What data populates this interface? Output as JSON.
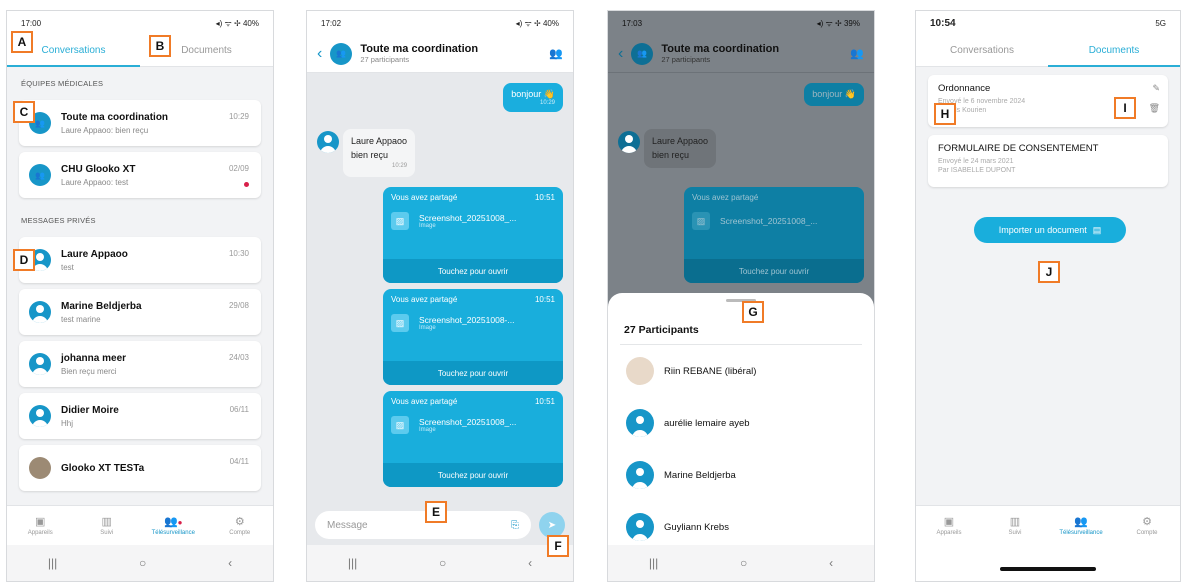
{
  "screens": {
    "conversations": {
      "status_time": "17:00",
      "status_right": "◂) ᯤ ✢ 40%",
      "tab_conversations": "Conversations",
      "tab_documents": "Documents",
      "section_medical": "ÉQUIPES MÉDICALES",
      "section_private": "MESSAGES PRIVÉS",
      "teams": [
        {
          "name": "Toute ma coordination",
          "preview": "Laure Appaoo: bien reçu",
          "date": "10:29"
        },
        {
          "name": "CHU Glooko XT",
          "preview": "Laure Appaoo: test",
          "date": "02/09"
        }
      ],
      "private": [
        {
          "name": "Laure Appaoo",
          "preview": "test",
          "date": "10:30"
        },
        {
          "name": "Marine Beldjerba",
          "preview": "test marine",
          "date": "29/08"
        },
        {
          "name": "johanna meer",
          "preview": "Bien reçu merci",
          "date": "24/03"
        },
        {
          "name": "Didier Moire",
          "preview": "Hhj",
          "date": "06/11"
        },
        {
          "name": "Glooko XT TESTa",
          "preview": "",
          "date": "04/11"
        }
      ]
    },
    "chat": {
      "status_time": "17:02",
      "status_right": "◂) ᯤ ✢ 40%",
      "title": "Toute ma coordination",
      "participants": "27 participants",
      "msg_out": "bonjour 👋",
      "msg_out_time": "10:29",
      "msg_in_author": "Laure Appaoo",
      "msg_in_text": "bien reçu",
      "msg_in_time": "10:29",
      "shares": [
        {
          "head": "Vous avez partagé",
          "time": "10:51",
          "file": "Screenshot_20251008_...",
          "type": "Image",
          "open": "Touchez pour ouvrir"
        },
        {
          "head": "Vous avez partagé",
          "time": "10:51",
          "file": "Screenshot_20251008-...",
          "type": "Image",
          "open": "Touchez pour ouvrir"
        },
        {
          "head": "Vous avez partagé",
          "time": "10:51",
          "file": "Screenshot_20251008_...",
          "type": "Image",
          "open": "Touchez pour ouvrir"
        }
      ],
      "input_placeholder": "Message"
    },
    "participants": {
      "status_time": "17:03",
      "status_right": "◂) ᯤ ✢ 39%",
      "sheet_title": "27 Participants",
      "list": [
        "Riin REBANE (libéral)",
        "aurélie lemaire ayeb",
        "Marine Beldjerba",
        "Guyliann Krebs"
      ]
    },
    "documents": {
      "status_time": "10:54",
      "status_right": "5G",
      "tab_conversations": "Conversations",
      "tab_documents": "Documents",
      "docs": [
        {
          "title": "Ordonnance",
          "line1": "Envoyé le 6 novembre 2024",
          "line2": "Par Ms Kourien"
        },
        {
          "title": "FORMULAIRE DE CONSENTEMENT",
          "line1": "Envoyé le 24 mars 2021",
          "line2": "Par ISABELLE DUPONT"
        }
      ],
      "import_label": "Importer un document"
    }
  },
  "nav": {
    "devices": "Appareils",
    "followup": "Suivi",
    "telemonitoring": "Télésurveillance",
    "account": "Compte"
  },
  "markers": [
    "A",
    "B",
    "C",
    "D",
    "E",
    "F",
    "G",
    "H",
    "I",
    "J"
  ],
  "colors": {
    "accent": "#19aedc",
    "primary": "#1796c8",
    "marker": "#f07b27",
    "alert": "#d8204a"
  }
}
